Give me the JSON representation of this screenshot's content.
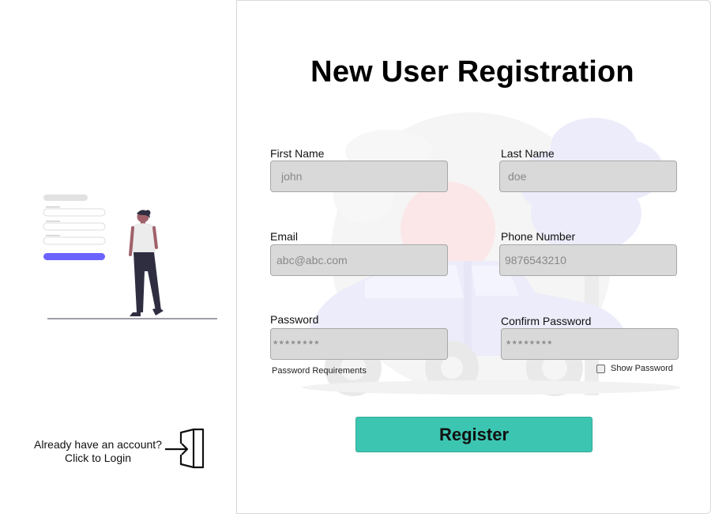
{
  "left_panel": {
    "login_prompt_line1": "Already have an account?",
    "login_prompt_line2": "Click to Login",
    "login_icon": "login-door-arrow-icon"
  },
  "form": {
    "title": "New User Registration",
    "fields": {
      "first_name": {
        "label": "First Name",
        "placeholder": "john"
      },
      "last_name": {
        "label": "Last Name",
        "placeholder": "doe"
      },
      "email": {
        "label": "Email",
        "placeholder": "abc@abc.com"
      },
      "phone": {
        "label": "Phone Number",
        "placeholder": "9876543210"
      },
      "password": {
        "label": "Password",
        "placeholder": "********"
      },
      "confirm_password": {
        "label": "Confirm Password",
        "placeholder": "********"
      }
    },
    "password_requirements": "Password Requirements",
    "show_password": "Show Password",
    "register_label": "Register"
  },
  "colors": {
    "accent": "#3cc6b1",
    "illustration_accent": "#6c63ff",
    "field_bg": "#d9d9d9"
  }
}
